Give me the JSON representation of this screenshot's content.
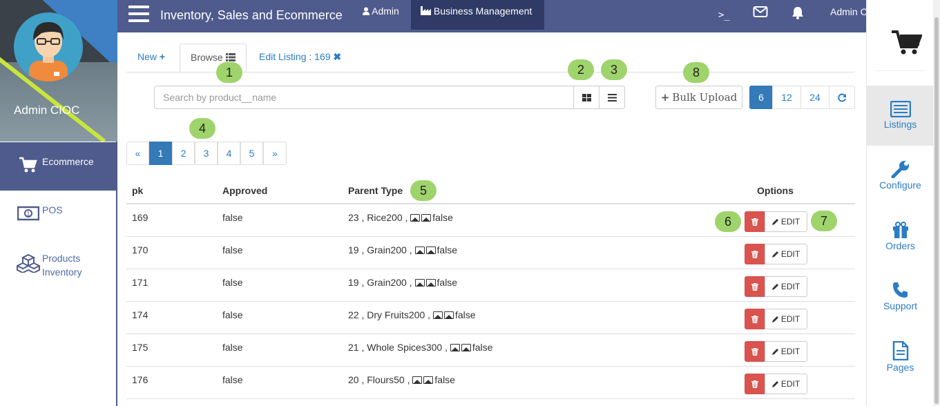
{
  "app": {
    "title": "Inventory, Sales and Ecommerce"
  },
  "topnav": {
    "admin": "Admin",
    "business": "Business Management",
    "terminal": ">_",
    "user": "Admin CIOC"
  },
  "profile": {
    "name": "Admin CIOC"
  },
  "sidebar": {
    "items": [
      {
        "label": "Ecommerce",
        "icon": "cart-icon"
      },
      {
        "label": "POS",
        "icon": "money-icon"
      },
      {
        "label": "Products\nInventory",
        "icon": "cubes-icon"
      }
    ]
  },
  "rightbar": {
    "items": [
      {
        "label": "Listings",
        "icon": "list-icon"
      },
      {
        "label": "Configure",
        "icon": "wrench-icon"
      },
      {
        "label": "Orders",
        "icon": "gift-icon"
      },
      {
        "label": "Support",
        "icon": "phone-icon"
      },
      {
        "label": "Pages",
        "icon": "file-icon"
      }
    ]
  },
  "tabs": {
    "new": "New",
    "browse": "Browse",
    "edit": "Edit Listing : 169"
  },
  "search": {
    "placeholder": "Search by product__name"
  },
  "bulk": {
    "label": "Bulk Upload"
  },
  "perpage": [
    "6",
    "12",
    "24"
  ],
  "pagination": [
    "«",
    "1",
    "2",
    "3",
    "4",
    "5",
    "»"
  ],
  "badges": [
    "1",
    "2",
    "3",
    "4",
    "5",
    "6",
    "7",
    "8"
  ],
  "table": {
    "headers": {
      "pk": "pk",
      "approved": "Approved",
      "parent": "Parent Type",
      "options": "Options"
    },
    "edit_label": "EDIT",
    "rows": [
      {
        "pk": "169",
        "approved": "false",
        "parent_pre": "23 , Rice200 ,",
        "parent_post": "false"
      },
      {
        "pk": "170",
        "approved": "false",
        "parent_pre": "19 , Grain200 ,",
        "parent_post": "false"
      },
      {
        "pk": "171",
        "approved": "false",
        "parent_pre": "19 , Grain200 ,",
        "parent_post": "false"
      },
      {
        "pk": "174",
        "approved": "false",
        "parent_pre": "22 , Dry Fruits200 ,",
        "parent_post": "false"
      },
      {
        "pk": "175",
        "approved": "false",
        "parent_pre": "21 , Whole Spices300 ,",
        "parent_post": "false"
      },
      {
        "pk": "176",
        "approved": "false",
        "parent_pre": "20 , Flours50 ,",
        "parent_post": "false"
      }
    ]
  },
  "colors": {
    "primary": "#4f5b8c",
    "dark": "#2f3a66",
    "link": "#2a7dc4",
    "danger": "#d9534f",
    "badge": "#9fd36c"
  }
}
